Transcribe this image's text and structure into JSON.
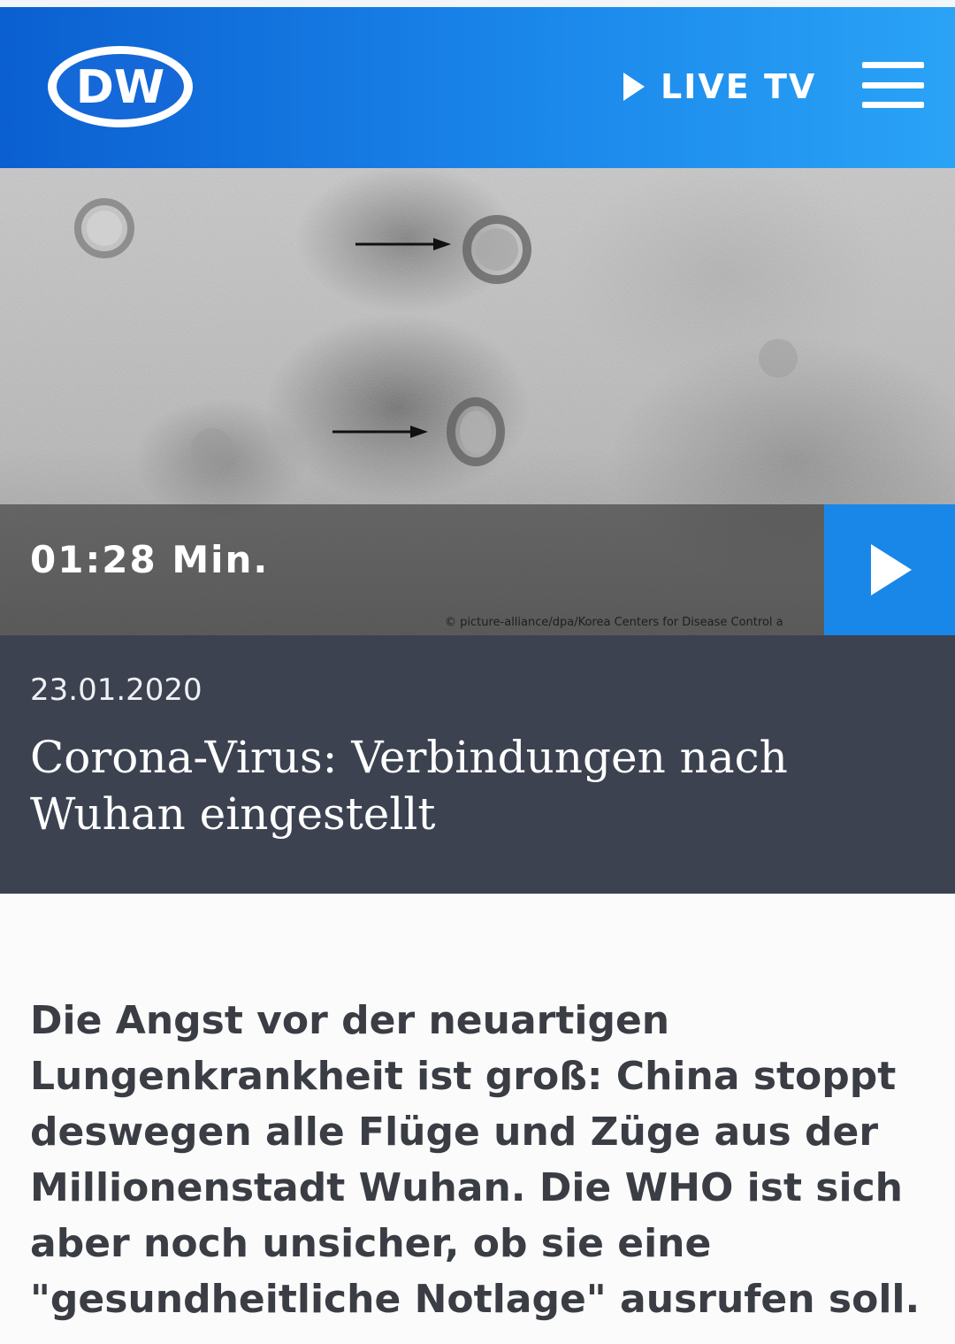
{
  "header": {
    "logo_text": "DW",
    "live_tv_label": "LIVE TV",
    "menu_icon": "hamburger-menu-icon"
  },
  "media": {
    "duration": "01:28 Min.",
    "credit": "© picture-alliance/dpa/Korea Centers for Disease Control a",
    "play_icon": "play-icon"
  },
  "article": {
    "date": "23.01.2020",
    "headline": "Corona-Virus: Verbindungen nach Wuhan eingestellt",
    "lead": "Die Angst vor der neuartigen Lungenkrankheit ist groß: China stoppt deswegen alle Flüge und Züge aus der Millionenstadt Wuhan. Die WHO ist sich aber noch unsicher, ob sie eine \"gesundheitliche Notlage\" ausrufen soll."
  },
  "colors": {
    "header_blue": "#1a86ea",
    "play_button_blue": "#1987e8",
    "caption_bg": "#3c4250"
  }
}
